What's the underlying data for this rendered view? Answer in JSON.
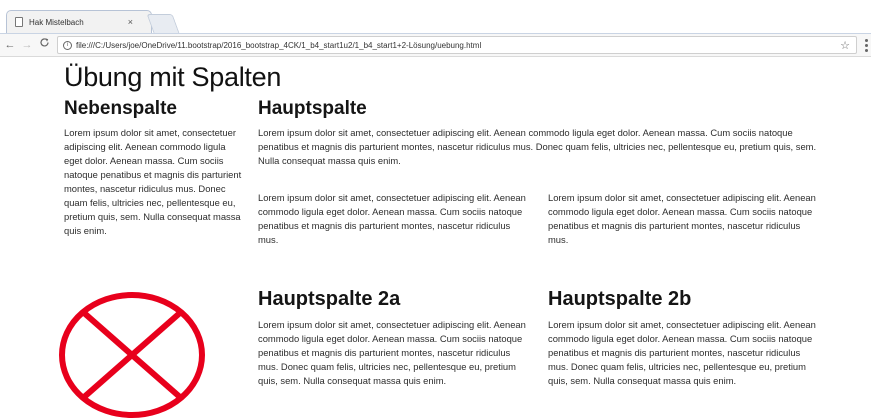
{
  "browser": {
    "tab_title": "Hak Mistelbach",
    "tab_close": "×",
    "back": "←",
    "forward": "→",
    "reload": "C",
    "info": "i",
    "url": "file:///C:/Users/joe/OneDrive/11.bootstrap/2016_bootstrap_4CK/1_b4_start1u2/1_b4_start1+2-Lösung/uebung.html",
    "star": "☆"
  },
  "page": {
    "title": "Übung mit Spalten",
    "side": {
      "heading": "Nebenspalte",
      "text": "Lorem ipsum dolor sit amet, consectetuer adipiscing elit. Aenean commodo ligula eget dolor. Aenean massa. Cum sociis natoque penatibus et magnis dis parturient montes, nascetur ridiculus mus. Donec quam felis, ultricies nec, pellentesque eu, pretium quis, sem. Nulla consequat massa quis enim."
    },
    "main": {
      "heading": "Hauptspalte",
      "text": "Lorem ipsum dolor sit amet, consectetuer adipiscing elit. Aenean commodo ligula eget dolor. Aenean massa. Cum sociis natoque penatibus et magnis dis parturient montes, nascetur ridiculus mus. Donec quam felis, ultricies nec, pellentesque eu, pretium quis, sem. Nulla consequat massa quis enim.",
      "col_left": "Lorem ipsum dolor sit amet, consectetuer adipiscing elit. Aenean commodo ligula eget dolor. Aenean massa. Cum sociis natoque penatibus et magnis dis parturient montes, nascetur ridiculus mus.",
      "col_right": "Lorem ipsum dolor sit amet, consectetuer adipiscing elit. Aenean commodo ligula eget dolor. Aenean massa. Cum sociis natoque penatibus et magnis dis parturient montes, nascetur ridiculus mus."
    },
    "main2a": {
      "heading": "Hauptspalte 2a",
      "text": "Lorem ipsum dolor sit amet, consectetuer adipiscing elit. Aenean commodo ligula eget dolor. Aenean massa. Cum sociis natoque penatibus et magnis dis parturient montes, nascetur ridiculus mus. Donec quam felis, ultricies nec, pellentesque eu, pretium quis, sem. Nulla consequat massa quis enim."
    },
    "main2b": {
      "heading": "Hauptspalte 2b",
      "text": "Lorem ipsum dolor sit amet, consectetuer adipiscing elit. Aenean commodo ligula eget dolor. Aenean massa. Cum sociis natoque penatibus et magnis dis parturient montes, nascetur ridiculus mus. Donec quam felis, ultricies nec, pellentesque eu, pretium quis, sem. Nulla consequat massa quis enim."
    }
  },
  "colors": {
    "x_mark": "#e8001c"
  }
}
